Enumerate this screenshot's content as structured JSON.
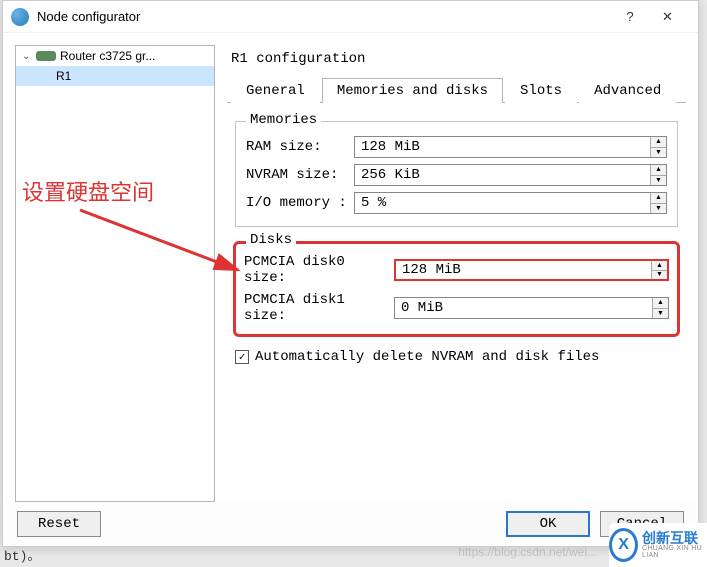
{
  "window": {
    "title": "Node configurator",
    "help": "?",
    "close": "✕"
  },
  "tree": {
    "root_label": "Router c3725 gr...",
    "child_label": "R1"
  },
  "panel": {
    "title": "R1 configuration",
    "tabs": {
      "general": "General",
      "memories": "Memories and disks",
      "slots": "Slots",
      "advanced": "Advanced"
    }
  },
  "memories": {
    "legend": "Memories",
    "ram_label": "RAM size:",
    "ram_value": "128 MiB",
    "nvram_label": "NVRAM size:",
    "nvram_value": "256 KiB",
    "io_label": "I/O memory :",
    "io_value": "5 %"
  },
  "disks": {
    "legend": "Disks",
    "disk0_label": "PCMCIA disk0 size:",
    "disk0_value": "128 MiB",
    "disk1_label": "PCMCIA disk1 size:",
    "disk1_value": "0 MiB"
  },
  "checkbox": {
    "label": "Automatically delete NVRAM and disk files",
    "checked": true,
    "mark": "✓"
  },
  "footer": {
    "reset": "Reset",
    "ok": "OK",
    "cancel": "Cancel"
  },
  "annotation": {
    "text": "设置硬盘空间"
  },
  "logo": {
    "brand": "创新互联",
    "tagline": "CHUANG XIN HU LIAN"
  },
  "watermark": "https://blog.csdn.net/wei...",
  "stray": "bt)。"
}
